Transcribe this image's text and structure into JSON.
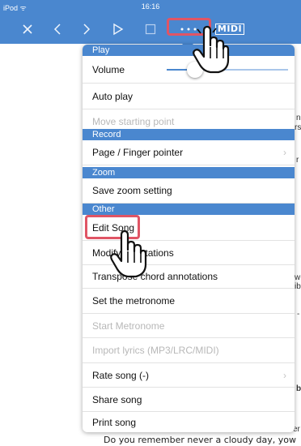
{
  "status_bar": {
    "carrier": "iPod ᯤ",
    "time": "16:16"
  },
  "toolbar": {
    "icons": [
      "close-icon",
      "back-icon",
      "forward-icon",
      "play-icon",
      "square-icon",
      "more-icon",
      "midi-icon"
    ],
    "midi_label": "MIDI"
  },
  "background": {
    "side_fragments": [
      "n",
      "rs",
      "r",
      "w",
      "ib",
      "-",
      "b",
      "er"
    ],
    "bottom_text": "Do you remember never a cloudy day, yow"
  },
  "menu": {
    "sections": {
      "play": "Play",
      "record": "Record",
      "zoom": "Zoom",
      "other": "Other"
    },
    "items": {
      "volume": "Volume",
      "auto_play": "Auto play",
      "move_starting_point": "Move starting point",
      "page_finger_pointer": "Page / Finger pointer",
      "save_zoom_setting": "Save zoom setting",
      "edit_song": "Edit Song",
      "modify_annotations": "Modify annotations",
      "transpose_chord_annotations": "Transpose chord annotations",
      "set_metronome": "Set the metronome",
      "start_metronome": "Start Metronome",
      "import_lyrics": "Import lyrics (MP3/LRC/MIDI)",
      "rate_song": "Rate song (-)",
      "share_song": "Share song",
      "print_song": "Print song"
    },
    "volume_level_fraction": 0.23,
    "chevron": "›"
  },
  "colors": {
    "accent": "#4a87cf",
    "highlight": "#e05565",
    "disabled": "#b8b8b8"
  }
}
